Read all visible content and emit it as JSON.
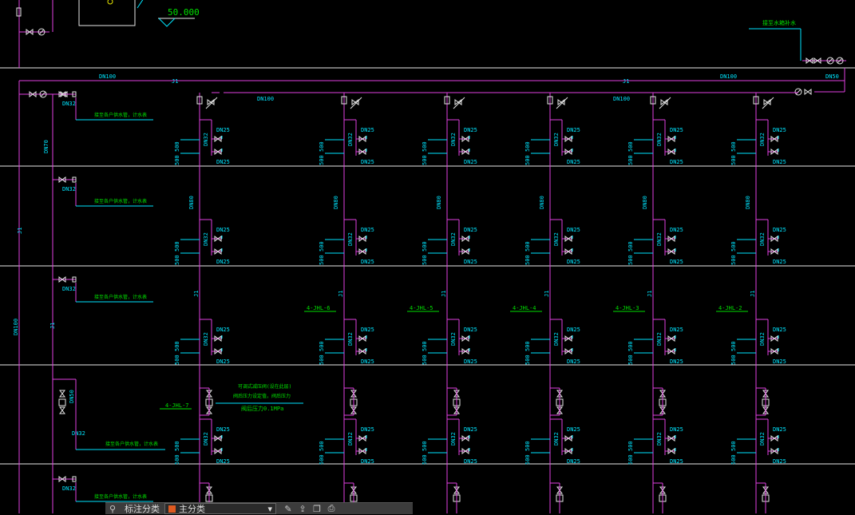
{
  "colors": {
    "pipe": "#e040e0",
    "text": "#00e5ff",
    "line": "#e8e8e8",
    "tag": "#00e000",
    "valve": "#e8e8e8"
  },
  "top": {
    "elevation": "50.000",
    "note": "接至水箱补水"
  },
  "mains": {
    "dn100": "DN100",
    "j1": "J1",
    "dn50": "DN50",
    "dn100_vert": "DN100",
    "dn70": "DN70",
    "j1_vert": "J1"
  },
  "floor_branch": {
    "dn32": "DN32",
    "dn50": "DN50",
    "note": "接至各户供水管，计水表"
  },
  "risers": [
    {
      "tag": "4-JHL-7"
    },
    {
      "tag": "4-JHL-6"
    },
    {
      "tag": "4-JHL-5"
    },
    {
      "tag": "4-JHL-4"
    },
    {
      "tag": "4-JHL-3"
    },
    {
      "tag": "4-JHL-2"
    }
  ],
  "riser_labels": {
    "dn80": "DN80",
    "dn32": "DN32",
    "dn25": "DN25",
    "dim": "500",
    "j1": "J1"
  },
  "note_block": {
    "line1": "可调式减压阀(设在此层)",
    "line2": "阀后压力设定值，阀后压力",
    "line3": "阀后压力0.1MPa"
  },
  "toolbar": {
    "layer_label": "标注分类",
    "layer_value": "主分类"
  }
}
